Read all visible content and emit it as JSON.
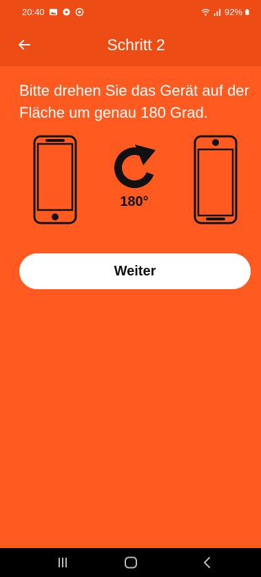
{
  "status_bar": {
    "time": "20:40",
    "battery": "92%",
    "icons": [
      "gallery-icon",
      "settings-icon",
      "notification-icon",
      "wifi-icon",
      "signal-icon",
      "battery-icon"
    ]
  },
  "app_bar": {
    "title": "Schritt 2",
    "back_icon": "arrow-left-icon"
  },
  "content": {
    "instruction": "Bitte drehen Sie das Gerät auf der Fläche um genau 180 Grad.",
    "rotation_label": "180°",
    "illustration_icons": [
      "phone-upright-icon",
      "rotate-clockwise-icon",
      "phone-upside-down-icon"
    ]
  },
  "actions": {
    "continue_label": "Weiter"
  },
  "nav_bar": {
    "icons": [
      "recent-apps-icon",
      "home-icon",
      "back-icon"
    ]
  },
  "colors": {
    "background": "#ff5a1f",
    "app_bar": "#ed4c15",
    "button": "#ffffff",
    "illustration": "#111111",
    "nav_bar": "#000000"
  }
}
